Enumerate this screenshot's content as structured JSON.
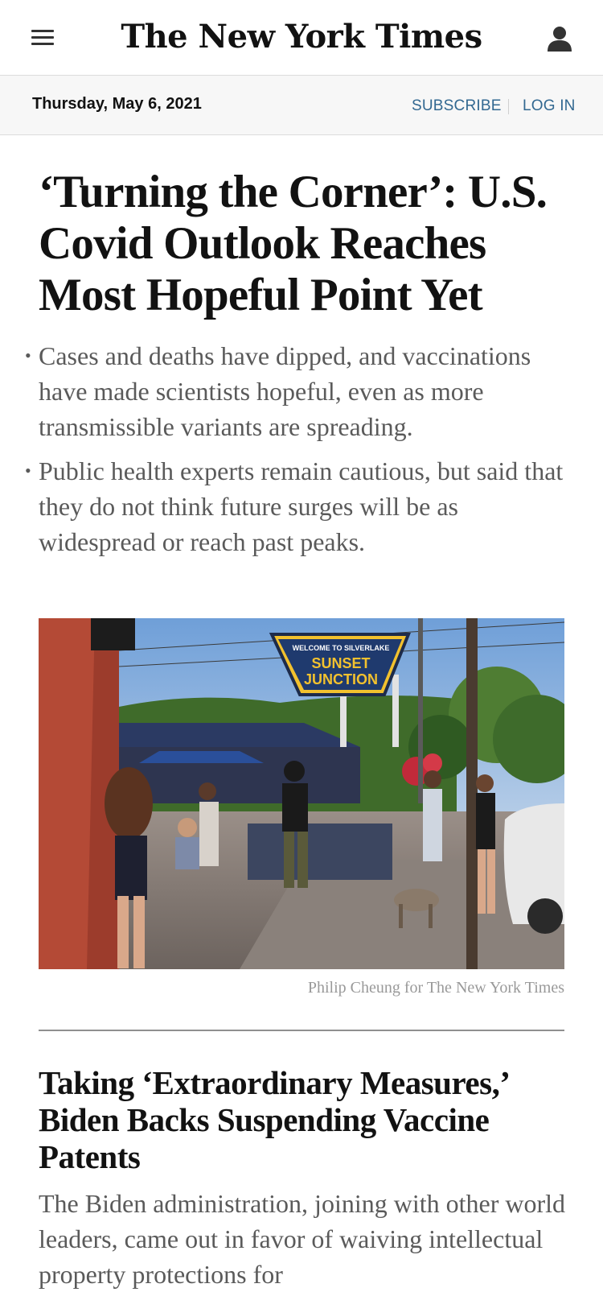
{
  "masthead": {
    "logo_text": "The New York Times",
    "menu_icon": "hamburger-menu-icon",
    "account_icon": "account-person-icon"
  },
  "datebar": {
    "date": "Thursday, May 6, 2021",
    "subscribe_label": "SUBSCRIBE",
    "login_label": "LOG IN"
  },
  "lead_story": {
    "headline": "‘Turning the Corner’: U.S. Covid Outlook Reaches Most Hopeful Point Yet",
    "summary_points": [
      "Cases and deaths have dipped, and vaccinations have made scientists hopeful, even as more transmissible variants are spreading.",
      "Public health experts remain cautious, but said that they do not think future surges will be as widespread or reach past peaks."
    ],
    "photo": {
      "sign_line1": "WELCOME TO SILVERLAKE",
      "sign_line2": "SUNSET",
      "sign_line3": "JUNCTION",
      "credit": "Philip Cheung for The New York Times"
    }
  },
  "second_story": {
    "headline": "Taking ‘Extraordinary Measures,’ Biden Backs Suspending Vaccine Patents",
    "summary": "The Biden administration, joining with other world leaders, came out in favor of waiving intellectual property protections for"
  },
  "colors": {
    "link_blue": "#326891",
    "summary_gray": "#5a5a5a",
    "datebar_bg": "#f7f7f7"
  }
}
